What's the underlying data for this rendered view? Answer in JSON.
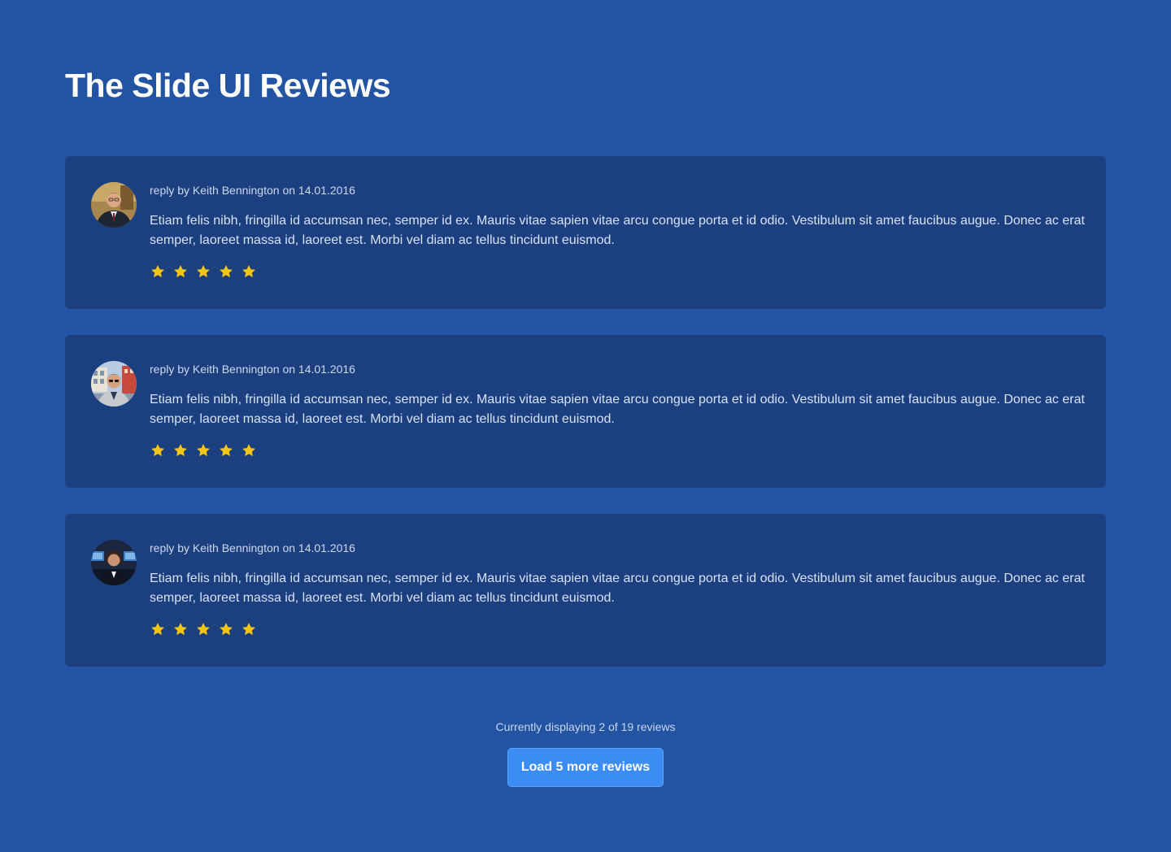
{
  "page": {
    "title": "The Slide UI Reviews"
  },
  "colors": {
    "background": "#2353a3",
    "card": "#1c3f7f",
    "star": "#f5c518",
    "button": "#3b8cf3"
  },
  "reviews": [
    {
      "meta": "reply by Keith Bennington on 14.01.2016",
      "text": "Etiam felis nibh, fringilla id accumsan nec, semper id ex. Mauris vitae sapien vitae arcu congue porta et id odio. Vestibulum sit amet faucibus augue. Donec ac erat semper, laoreet massa id, laoreet est. Morbi vel diam ac tellus tincidunt euismod.",
      "rating": 5,
      "rating_max": 5,
      "avatar_icon": "avatar-man-suit-icon"
    },
    {
      "meta": "reply by Keith Bennington on 14.01.2016",
      "text": "Etiam felis nibh, fringilla id accumsan nec, semper id ex. Mauris vitae sapien vitae arcu congue porta et id odio. Vestibulum sit amet faucibus augue. Donec ac erat semper, laoreet massa id, laoreet est. Morbi vel diam ac tellus tincidunt euismod.",
      "rating": 5,
      "rating_max": 5,
      "avatar_icon": "avatar-man-outdoor-icon"
    },
    {
      "meta": "reply by Keith Bennington on 14.01.2016",
      "text": "Etiam felis nibh, fringilla id accumsan nec, semper id ex. Mauris vitae sapien vitae arcu congue porta et id odio. Vestibulum sit amet faucibus augue. Donec ac erat semper, laoreet massa id, laoreet est. Morbi vel diam ac tellus tincidunt euismod.",
      "rating": 5,
      "rating_max": 5,
      "avatar_icon": "avatar-woman-office-icon"
    }
  ],
  "footer": {
    "status": "Currently displaying 2 of 19 reviews",
    "load_button_label": "Load 5 more reviews"
  }
}
